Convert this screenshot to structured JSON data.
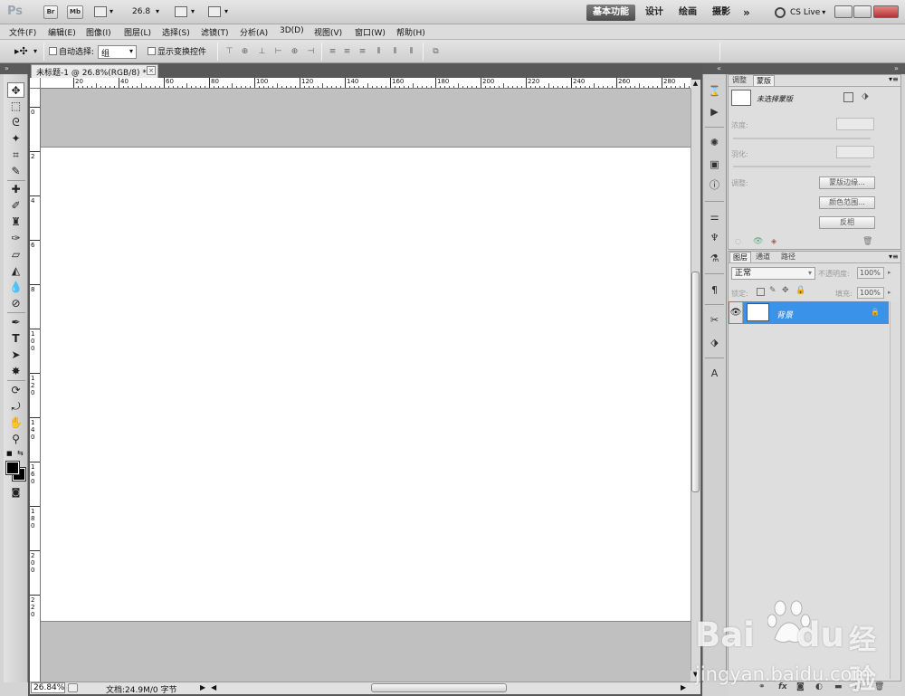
{
  "app": {
    "logo": "Ps",
    "bridge_label": "Br",
    "minibridge_label": "Mb",
    "zoom_value": "26.8",
    "workspaces": [
      "基本功能",
      "设计",
      "绘画",
      "摄影"
    ],
    "more": "»",
    "cslive": "CS Live"
  },
  "menu": [
    "文件(F)",
    "编辑(E)",
    "图像(I)",
    "图层(L)",
    "选择(S)",
    "滤镜(T)",
    "分析(A)",
    "3D(D)",
    "视图(V)",
    "窗口(W)",
    "帮助(H)"
  ],
  "options": {
    "auto_select_label": "自动选择:",
    "auto_select_value": "组",
    "show_transform_label": "显示变换控件"
  },
  "document": {
    "tab_title": "未标题-1 @ 26.8%(RGB/8) *",
    "close": "×",
    "hruler": [
      "20",
      "40",
      "60",
      "80",
      "100",
      "120",
      "140",
      "160",
      "180",
      "200",
      "220",
      "240",
      "260",
      "280"
    ],
    "vruler": [
      "0",
      "2",
      "4",
      "6",
      "8",
      "100",
      "120",
      "140",
      "160",
      "180",
      "200",
      "220"
    ],
    "zoom_percent": "26.84%",
    "doc_info": "文档:24.9M/0 字节"
  },
  "masks_panel": {
    "tabs": [
      "调整",
      "蒙版"
    ],
    "active_tab": 1,
    "no_selection": "未选择蒙版",
    "density_label": "浓度:",
    "feather_label": "羽化:",
    "refine_label": "调整:",
    "buttons": [
      "蒙版边缘...",
      "颜色范围...",
      "反相"
    ]
  },
  "layers_panel": {
    "tabs": [
      "图层",
      "通道",
      "路径"
    ],
    "active_tab": 0,
    "blend_mode": "正常",
    "opacity_label": "不透明度:",
    "opacity_value": "100%",
    "lock_label": "锁定:",
    "fill_label": "填充:",
    "fill_value": "100%",
    "layers": [
      {
        "name": "背景",
        "visible": true,
        "locked": true
      }
    ]
  },
  "watermark": {
    "brand": "Bai",
    "brand2": "du",
    "cn": "经验",
    "url": "jingyan.baidu.com"
  },
  "colors": {
    "selected_layer": "#3b93e9",
    "foreground": "#000000",
    "background": "#000000"
  }
}
